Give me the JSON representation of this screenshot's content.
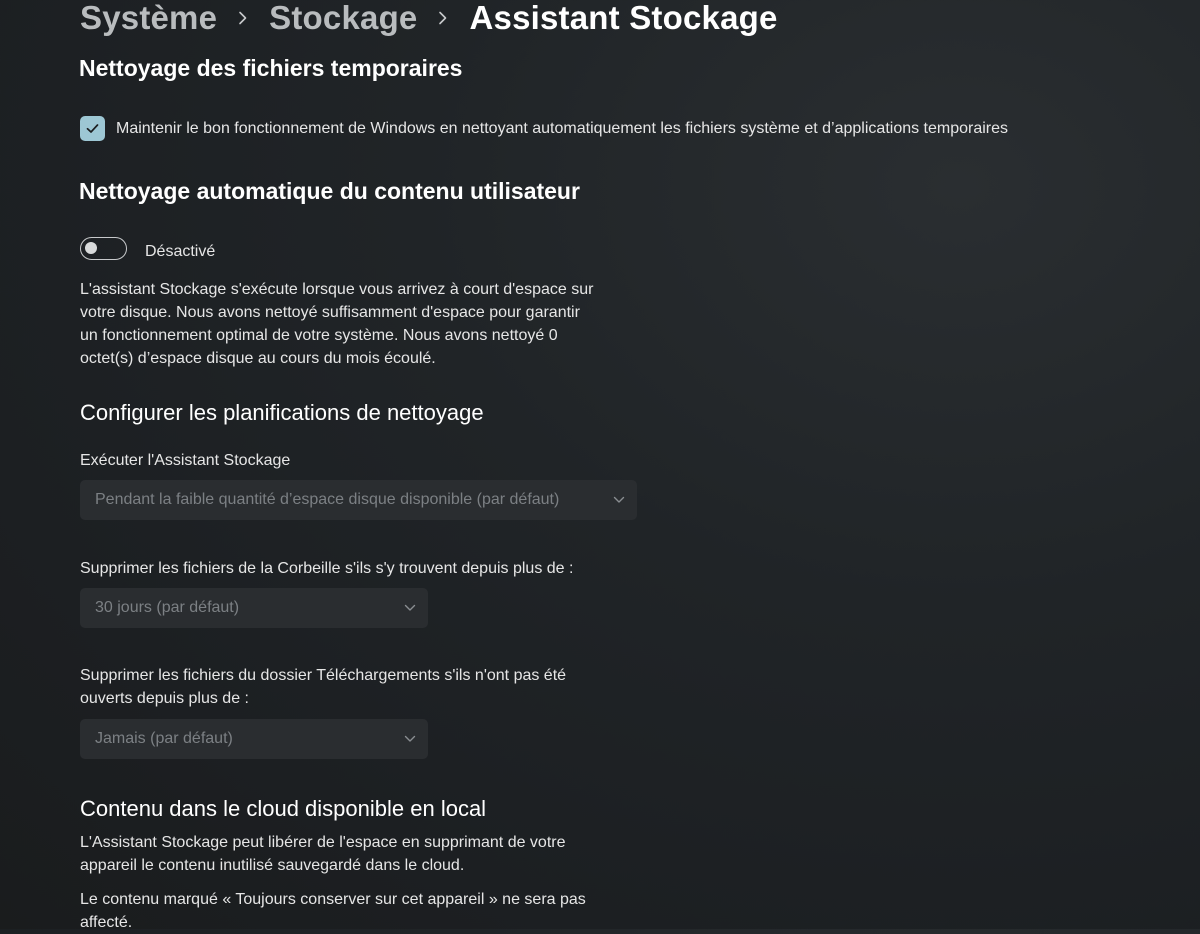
{
  "breadcrumb": {
    "items": [
      "Système",
      "Stockage",
      "Assistant Stockage"
    ]
  },
  "temp_cleanup": {
    "title": "Nettoyage des fichiers temporaires",
    "checkbox_checked": true,
    "checkbox_label": "Maintenir le bon fonctionnement de Windows en nettoyant automatiquement les fichiers système et d’applications temporaires"
  },
  "auto_cleanup": {
    "title": "Nettoyage automatique du contenu utilisateur",
    "toggle_on": false,
    "toggle_label": "Désactivé",
    "description_lines": [
      "L'assistant Stockage s'exécute lorsque vous arrivez à court d'espace sur",
      "votre disque. Nous avons nettoyé suffisamment d'espace pour garantir",
      "un fonctionnement optimal de votre système. Nous avons nettoyé 0",
      "octet(s) d’espace disque au cours du mois écoulé."
    ]
  },
  "schedules": {
    "title": "Configurer les planifications de nettoyage",
    "run_label": "Exécuter l'Assistant Stockage",
    "run_value": "Pendant la faible quantité d’espace disque disponible (par défaut)",
    "recycle_label": "Supprimer les fichiers de la Corbeille s'ils s'y trouvent depuis plus de :",
    "recycle_value": "30 jours (par défaut)",
    "downloads_label_lines": [
      "Supprimer les fichiers du dossier Téléchargements s'ils n'ont pas été",
      "ouverts depuis plus de :"
    ],
    "downloads_value": "Jamais (par défaut)"
  },
  "cloud": {
    "title": "Contenu dans le cloud disponible en local",
    "description_lines": [
      "L'Assistant Stockage peut libérer de l'espace en supprimant de votre",
      "appareil le contenu inutilisé sauvegardé dans le cloud."
    ],
    "note_lines": [
      "Le contenu marqué « Toujours conserver sur cet appareil » ne sera pas",
      "affecté."
    ]
  },
  "colors": {
    "accent": "#9dc7d4",
    "background": "#202427",
    "dropdown_bg": "#2a2d30",
    "disabled_text": "#7c8084"
  },
  "icons": {
    "breadcrumb_separator": "chevron-right-icon",
    "checkbox": "checkmark-icon",
    "dropdown": "chevron-down-icon"
  }
}
